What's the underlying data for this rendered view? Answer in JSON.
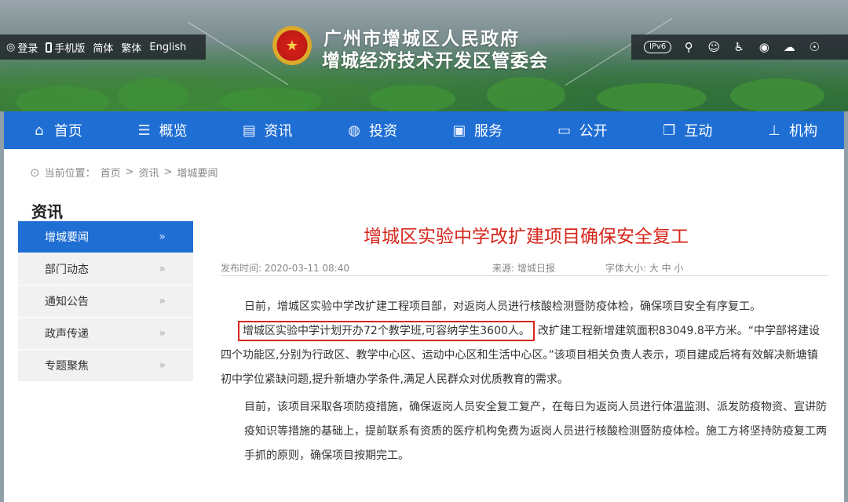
{
  "topbar": {
    "login": "登录",
    "mobile": "手机版",
    "simplified": "简体",
    "traditional": "繁体",
    "english": "English",
    "ipv6": "IPv6"
  },
  "header": {
    "title_line1": "广州市增城区人民政府",
    "title_line2": "增城经济技术开发区管委会"
  },
  "nav": {
    "items": [
      {
        "label": "首页",
        "icon": "home-icon"
      },
      {
        "label": "概览",
        "icon": "list-icon"
      },
      {
        "label": "资讯",
        "icon": "news-icon"
      },
      {
        "label": "投资",
        "icon": "globe-icon"
      },
      {
        "label": "服务",
        "icon": "briefcase-icon"
      },
      {
        "label": "公开",
        "icon": "monitor-icon"
      },
      {
        "label": "互动",
        "icon": "chat-icon"
      },
      {
        "label": "机构",
        "icon": "org-icon"
      }
    ]
  },
  "breadcrumb": {
    "prefix": "当前位置：",
    "home": "首页",
    "sep": ">",
    "level1": "资讯",
    "level2": "增城要闻"
  },
  "sidebar": {
    "title": "资讯",
    "chevron": "»",
    "items": [
      {
        "label": "增城要闻"
      },
      {
        "label": "部门动态"
      },
      {
        "label": "通知公告"
      },
      {
        "label": "政声传递"
      },
      {
        "label": "专题聚焦"
      }
    ]
  },
  "article": {
    "title": "增城区实验中学改扩建项目确保安全复工",
    "publish_time": "发布时间: 2020-03-11 08:40",
    "source": "来源: 增城日报",
    "font_size": "字体大小: 大 中 小",
    "para1": "日前，增城区实验中学改扩建工程项目部，对返岗人员进行核酸检测暨防疫体检，确保项目安全有序复工。",
    "para2_highlight": "增城区实验中学计划开办72个教学班,可容纳学生3600人。",
    "para2_rest": "改扩建工程新增建筑面积83049.8平方米。“中学部将建设四个功能区,分别为行政区、教学中心区、运动中心区和生活中心区。”该项目相关负责人表示，项目建成后将有效解决新塘镇初中学位紧缺问题,提升新塘办学条件,满足人民群众对优质教育的需求。",
    "para3": "目前，该项目采取各项防疫措施，确保返岗人员安全复工复产，在每日为返岗人员进行体温监测、派发防疫物资、宣讲防疫知识等措施的基础上，提前联系有资质的医疗机构免费为返岗人员进行核酸检测暨防疫体检。施工方将坚持防疫复工两手抓的原则，确保项目按期完工。"
  },
  "colors": {
    "nav_blue": "#1f6ed4",
    "title_red": "#d6261c"
  }
}
